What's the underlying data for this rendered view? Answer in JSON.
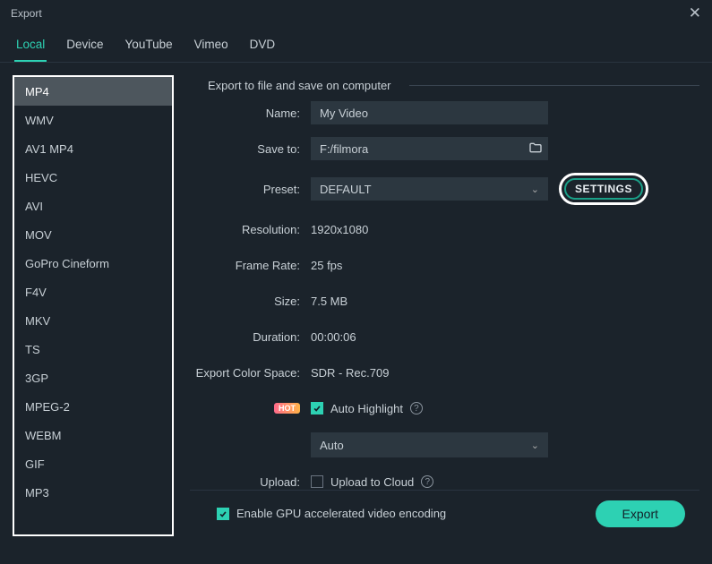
{
  "window": {
    "title": "Export"
  },
  "tabs": [
    "Local",
    "Device",
    "YouTube",
    "Vimeo",
    "DVD"
  ],
  "active_tab": 0,
  "formats": [
    "MP4",
    "WMV",
    "AV1 MP4",
    "HEVC",
    "AVI",
    "MOV",
    "GoPro Cineform",
    "F4V",
    "MKV",
    "TS",
    "3GP",
    "MPEG-2",
    "WEBM",
    "GIF",
    "MP3"
  ],
  "selected_format": 0,
  "section_heading": "Export to file and save on computer",
  "fields": {
    "name": {
      "label": "Name:",
      "value": "My Video"
    },
    "save_to": {
      "label": "Save to:",
      "value": "F:/filmora"
    },
    "preset": {
      "label": "Preset:",
      "value": "DEFAULT",
      "settings_button": "SETTINGS"
    },
    "resolution": {
      "label": "Resolution:",
      "value": "1920x1080"
    },
    "frame_rate": {
      "label": "Frame Rate:",
      "value": "25 fps"
    },
    "size": {
      "label": "Size:",
      "value": "7.5 MB"
    },
    "duration": {
      "label": "Duration:",
      "value": "00:00:06"
    },
    "color_space": {
      "label": "Export Color Space:",
      "value": "SDR - Rec.709"
    },
    "auto_highlight": {
      "hot_badge": "HOT",
      "label": "Auto Highlight",
      "checked": true,
      "dropdown_value": "Auto"
    },
    "upload": {
      "label": "Upload:",
      "checkbox_label": "Upload to Cloud",
      "checked": false
    }
  },
  "footer": {
    "gpu_label": "Enable GPU accelerated video encoding",
    "gpu_checked": true,
    "export_button": "Export"
  }
}
